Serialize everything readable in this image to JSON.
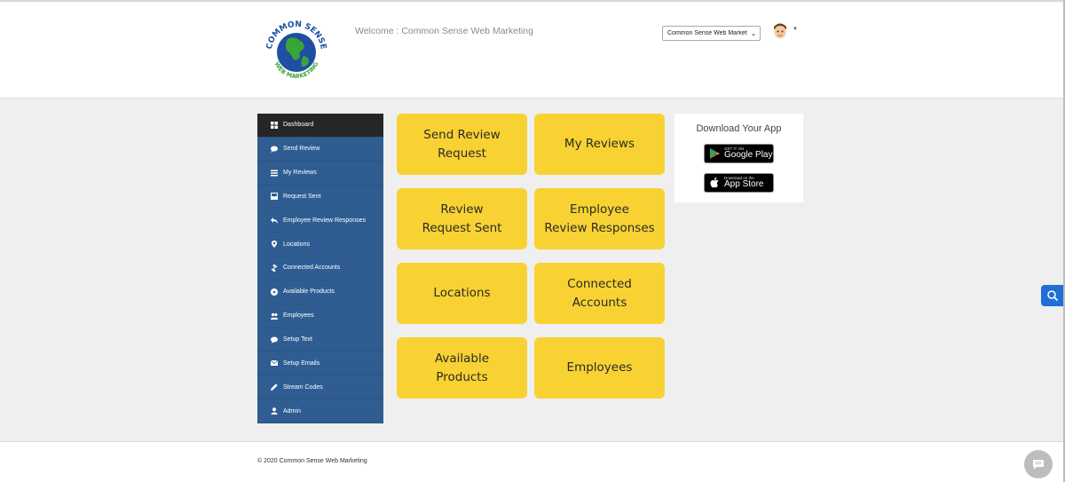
{
  "header": {
    "logo_text_top": "COMMON SENSE",
    "logo_text_bottom": "WEB MARKETING",
    "welcome_label": "Welcome : Common Sense Web Marketing",
    "account_select_value": "Common Sense Web Marketi"
  },
  "sidebar": {
    "items": [
      {
        "label": "Dashboard",
        "icon": "dashboard-icon"
      },
      {
        "label": "Send Review",
        "icon": "chat-icon"
      },
      {
        "label": "My Reviews",
        "icon": "list-icon"
      },
      {
        "label": "Request Sent",
        "icon": "inbox-icon"
      },
      {
        "label": "Employee Review Responses",
        "icon": "reply-icon"
      },
      {
        "label": "Locations",
        "icon": "map-pin-icon"
      },
      {
        "label": "Connected Accounts",
        "icon": "link-icon"
      },
      {
        "label": "Available Products",
        "icon": "product-icon"
      },
      {
        "label": "Employees",
        "icon": "users-icon"
      },
      {
        "label": "Setup Text",
        "icon": "comment-icon"
      },
      {
        "label": "Setup Emails",
        "icon": "envelope-icon"
      },
      {
        "label": "Stream Codes",
        "icon": "pencil-icon"
      },
      {
        "label": "Admin",
        "icon": "user-icon"
      }
    ]
  },
  "tiles": [
    {
      "label": "Send Review\nRequest"
    },
    {
      "label": "My Reviews"
    },
    {
      "label": "Review\nRequest Sent"
    },
    {
      "label": "Employee\nReview Responses"
    },
    {
      "label": "Locations"
    },
    {
      "label": "Connected\nAccounts"
    },
    {
      "label": "Available\nProducts"
    },
    {
      "label": "Employees"
    }
  ],
  "app_panel": {
    "title": "Download Your App",
    "google_small": "GET IT ON",
    "google_big": "Google Play",
    "apple_small": "Download on the",
    "apple_big": "App Store"
  },
  "footer": {
    "copyright": "© 2020 Common Sense Web Marketing"
  },
  "colors": {
    "sidebar": "#2f5d92",
    "sidebar_active": "#252627",
    "tile": "#f8d232",
    "accent_blue": "#1f6fd6"
  }
}
